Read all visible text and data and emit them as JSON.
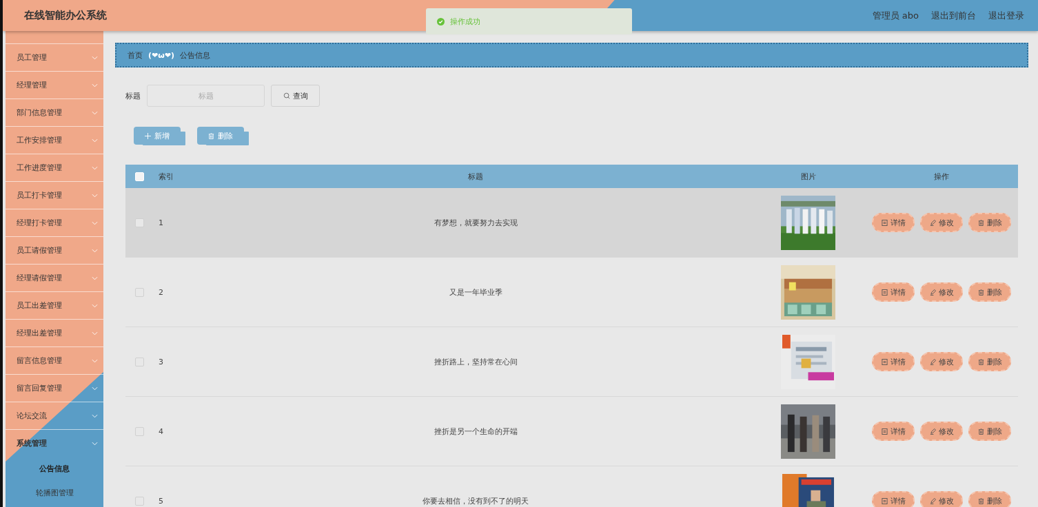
{
  "header": {
    "title": "在线智能办公系统",
    "user": "管理员 abo",
    "links": [
      "退出到前台",
      "退出登录"
    ]
  },
  "toast": {
    "message": "操作成功"
  },
  "sidebar": {
    "items": [
      {
        "label": "员工管理",
        "expanded": false
      },
      {
        "label": "经理管理",
        "expanded": false
      },
      {
        "label": "部门信息管理",
        "expanded": false
      },
      {
        "label": "工作安排管理",
        "expanded": false
      },
      {
        "label": "工作进度管理",
        "expanded": false
      },
      {
        "label": "员工打卡管理",
        "expanded": false
      },
      {
        "label": "经理打卡管理",
        "expanded": false
      },
      {
        "label": "员工请假管理",
        "expanded": false
      },
      {
        "label": "经理请假管理",
        "expanded": false
      },
      {
        "label": "员工出差管理",
        "expanded": false
      },
      {
        "label": "经理出差管理",
        "expanded": false
      },
      {
        "label": "留言信息管理",
        "expanded": false
      },
      {
        "label": "留言回复管理",
        "expanded": false
      },
      {
        "label": "论坛交流",
        "expanded": false
      },
      {
        "label": "系统管理",
        "expanded": true,
        "children": [
          {
            "label": "公告信息",
            "selected": true
          },
          {
            "label": "轮播图管理",
            "selected": false
          }
        ]
      }
    ]
  },
  "breadcrumb": {
    "home": "首页",
    "separator": "(❤ω❤)",
    "current": "公告信息"
  },
  "search": {
    "label": "标题",
    "placeholder": "标题",
    "button": "查询"
  },
  "actions": [
    {
      "label": "新增",
      "kind": "add"
    },
    {
      "label": "删除",
      "kind": "delete"
    }
  ],
  "table": {
    "all_checked": false,
    "columns": [
      "索引",
      "标题",
      "图片",
      "操作"
    ],
    "rows": [
      {
        "index": "1",
        "title": "有梦想，就要努力去实现",
        "checked": false,
        "highlighted": true,
        "picture": {
          "kind": "picture"
        },
        "actions": [
          {
            "label": "详情",
            "kind": "detail"
          },
          {
            "label": "修改",
            "kind": "edit"
          },
          {
            "label": "删除",
            "kind": "delete"
          }
        ]
      },
      {
        "index": "2",
        "title": "又是一年毕业季",
        "checked": false,
        "highlighted": false,
        "picture": {
          "kind": "picture"
        },
        "actions": [
          {
            "label": "详情",
            "kind": "detail"
          },
          {
            "label": "修改",
            "kind": "edit"
          },
          {
            "label": "删除",
            "kind": "delete"
          }
        ]
      },
      {
        "index": "3",
        "title": "挫折路上，坚持常在心间",
        "checked": false,
        "highlighted": false,
        "picture": {
          "kind": "picture"
        },
        "actions": [
          {
            "label": "详情",
            "kind": "detail"
          },
          {
            "label": "修改",
            "kind": "edit"
          },
          {
            "label": "删除",
            "kind": "delete"
          }
        ]
      },
      {
        "index": "4",
        "title": "挫折是另一个生命的开端",
        "checked": false,
        "highlighted": false,
        "picture": {
          "kind": "picture"
        },
        "actions": [
          {
            "label": "详情",
            "kind": "detail"
          },
          {
            "label": "修改",
            "kind": "edit"
          },
          {
            "label": "删除",
            "kind": "delete"
          }
        ]
      },
      {
        "index": "5",
        "title": "你要去相信，没有到不了的明天",
        "checked": false,
        "highlighted": false,
        "picture": {
          "kind": "picture"
        },
        "actions": [
          {
            "label": "详情",
            "kind": "detail"
          },
          {
            "label": "修改",
            "kind": "edit"
          },
          {
            "label": "删除",
            "kind": "delete"
          }
        ]
      }
    ]
  }
}
